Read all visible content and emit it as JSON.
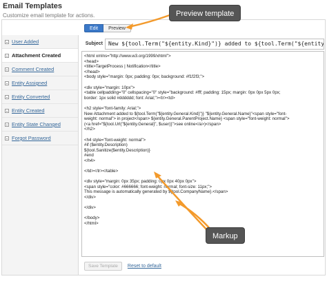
{
  "header": {
    "title": "Email Templates",
    "subtitle": "Customize email template for actions."
  },
  "sidebar": {
    "items": [
      {
        "label": "User Added",
        "active": false
      },
      {
        "label": "Attachment Created",
        "active": true
      },
      {
        "label": "Comment Created",
        "active": false
      },
      {
        "label": "Entity Assigned",
        "active": false
      },
      {
        "label": "Entity Converted",
        "active": false
      },
      {
        "label": "Entity Created",
        "active": false
      },
      {
        "label": "Entity State Changed",
        "active": false
      },
      {
        "label": "Forgot Password",
        "active": false
      }
    ]
  },
  "tabs": {
    "edit": "Edit",
    "preview": "Preview"
  },
  "subject": {
    "label": "Subject",
    "value": "New ${tool.Term(\"${entity.Kind}\")} added to ${tool.Term(\"${entity.General.Kind}\")}"
  },
  "markup": "<html xmlns=\"http://www.w3.org/1999/xhtml\">\n<head>\n<title>TargetProcess | Notification</title>\n</head>\n<body style=\"margin: 0px; padding: 0px; background: #f1f2f3;\">\n\n<div style=\"margin: 10px\">\n<table cellpadding=\"0\" cellspacing=\"0\" style=\"background: #fff; padding: 15px; margin: 0px 0px 5px 0px;\nborder: 1px solid #dddddd; font: Arial;\"><tr><td>\n\n<h2 style=\"font-family: Arial;\">\nNew Attachment added to ${tool.Term(\"${entity.General.Kind}\")} \"${entity.General.Name}\"<span style=\"font-\nweight: normal\"> in project</span> ${entity.General.ParentProject.Name} <span style=\"font-weight: normal\">\n(<a href=\"${tool.Url(\"${entity.General}\", $user)}\">see online</a>)</span>\n</h2>\n\n<h4 style=\"font-weight: normal\">\n#if ($entity.Description)\n${tool.Sanitize($entity.Description)}\n#end\n</h4>\n\n</td></tr></table>\n\n<div style=\"margin: 0px 35px; padding: 0px 0px 40px 0px\">\n<span style=\"color: #666666; font-weight: normal; font-size: 11px;\">\nThis message is automatically generated by ${tool.CompanyName}.</span>\n</div>\n\n</div>\n\n</body>\n</html>",
  "footer": {
    "save_label": "Save Template",
    "reset_label": "Reset to default"
  },
  "callouts": {
    "preview": "Preview template",
    "markup": "Markup"
  },
  "colors": {
    "accent": "#3a78c8",
    "arrow": "#f39a2c",
    "callout_bg": "#555555",
    "link": "#336699"
  }
}
